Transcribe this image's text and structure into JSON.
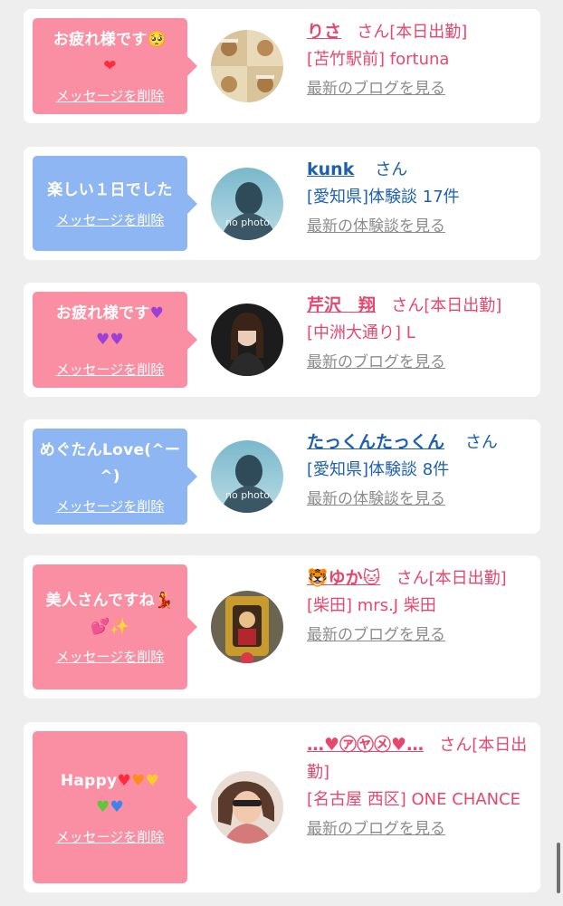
{
  "delete_label": "メッセージを削除",
  "blog_link": "最新のブログを見る",
  "review_link": "最新の体験談を見る",
  "san": "さん",
  "cards": [
    {
      "message": "お疲れ様です🥺",
      "emoji2": "❤️",
      "name": "りさ",
      "status": "[本日出勤]",
      "meta": "[苫竹駅前] fortuna"
    },
    {
      "message": "楽しい１日でした",
      "name": "kunk",
      "meta": "[愛知県]体験談 17件",
      "avatar_text": "no photo"
    },
    {
      "message": "お疲れ様です",
      "emoji2": "💜💜",
      "name": "芹沢　翔",
      "status": "[本日出勤]",
      "meta": "[中洲大通り] L"
    },
    {
      "message": "めぐたんLove(^ー^)",
      "name": "たっくんたっくん",
      "meta": "[愛知県]体験談 8件",
      "avatar_text": "no photo"
    },
    {
      "message": "美人さんですね💃",
      "emoji2": "💕✨",
      "name": "🐯ゆか🐱",
      "status": "[本日出勤]",
      "meta": "[柴田] mrs.J 柴田"
    },
    {
      "message": "Happy",
      "emoji2": "💚💙",
      "name": "…♥㋐㋳㋱♥…",
      "status": "[本日出勤]",
      "meta": "[名古屋 西区] ONE CHANCE"
    }
  ],
  "colors": {
    "pink": "#fa8fa3",
    "blue": "#8db6f3",
    "name_pink": "#e5476e",
    "name_blue": "#1e5fae"
  }
}
